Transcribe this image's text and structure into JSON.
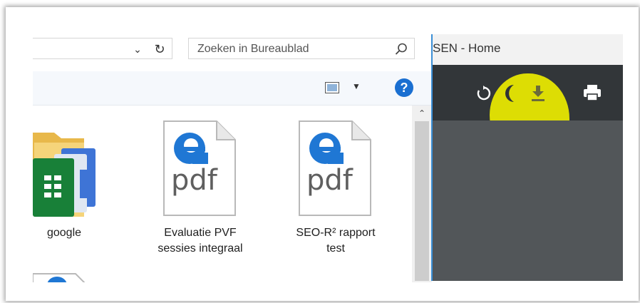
{
  "explorer": {
    "search": {
      "placeholder": "Zoeken in Bureaublad"
    },
    "help_label": "?",
    "files": [
      {
        "label": "google",
        "icon": "folder-google-sheets-icon"
      },
      {
        "label_line1": "Evaluatie PVF",
        "label_line2": "sessies integraal",
        "icon": "edge-pdf-file-icon",
        "badge": "pdf"
      },
      {
        "label_line1": "SEO-R² rapport",
        "label_line2": "test",
        "icon": "edge-pdf-file-icon",
        "badge": "pdf"
      }
    ]
  },
  "viewer": {
    "title": "SEN - Home",
    "toolbar": {
      "rotate": "rotate-icon",
      "download": "download-icon",
      "print": "print-icon"
    },
    "highlight_color": "#ecec00",
    "toolbar_color": "#323639",
    "body_color": "#525659"
  },
  "colors": {
    "accent": "#1a6fd1",
    "edge_blue": "#1f77d4"
  }
}
